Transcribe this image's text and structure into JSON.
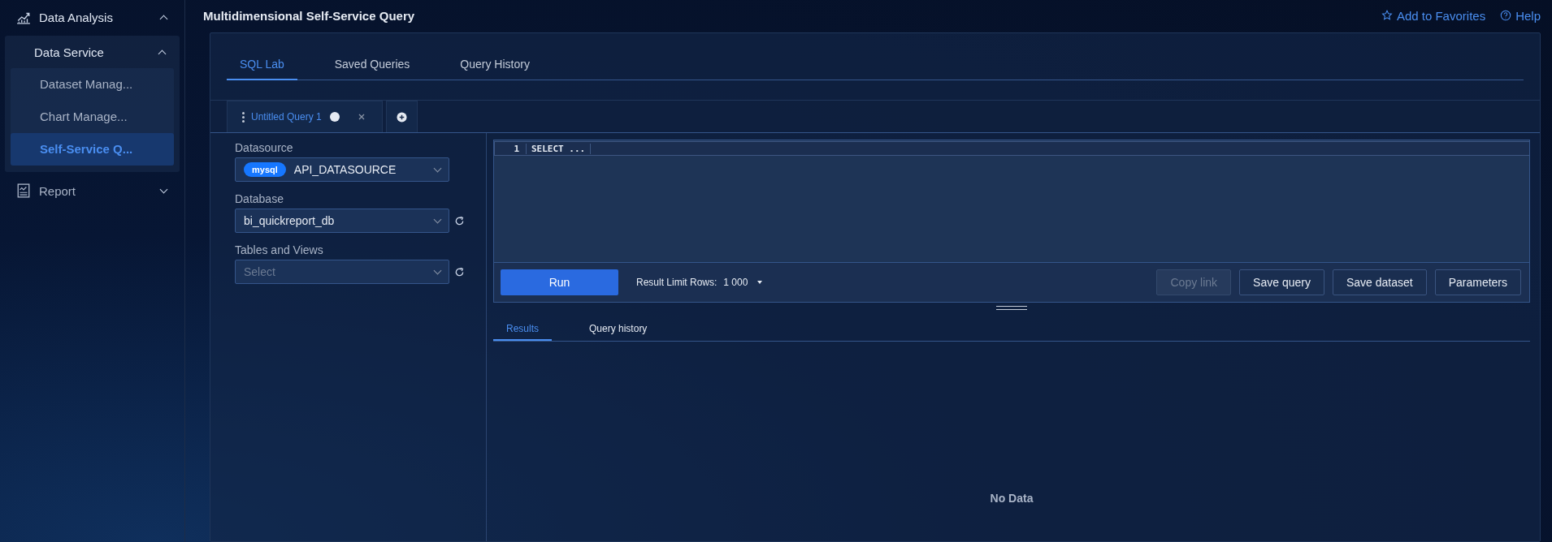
{
  "sidebar": {
    "items": [
      {
        "label": "Data Analysis",
        "expanded": true,
        "children": [
          {
            "label": "Data Service",
            "expanded": true,
            "children": [
              {
                "label": "Dataset Manag...",
                "selected": false
              },
              {
                "label": "Chart Manage...",
                "selected": false
              },
              {
                "label": "Self-Service Q...",
                "selected": true
              }
            ]
          }
        ]
      },
      {
        "label": "Report",
        "expanded": false
      }
    ]
  },
  "header": {
    "title": "Multidimensional Self-Service Query",
    "links": [
      {
        "label": "Add to Favorites"
      },
      {
        "label": "Help"
      }
    ]
  },
  "tabs": [
    {
      "label": "SQL Lab",
      "selected": true
    },
    {
      "label": "Saved Queries",
      "selected": false
    },
    {
      "label": "Query History",
      "selected": false
    }
  ],
  "query_tabs": [
    {
      "label": "Untitled Query 1",
      "selected": true
    }
  ],
  "form": [
    {
      "label": "Datasource",
      "kind": "tagged",
      "tag": "mysql",
      "value": "API_DATASOURCE",
      "refresh": false
    },
    {
      "label": "Database",
      "kind": "value",
      "value": "bi_quickreport_db",
      "refresh": true
    },
    {
      "label": "Tables and Views",
      "kind": "placeholder",
      "placeholder": "Select",
      "refresh": true
    }
  ],
  "editor": {
    "lines": [
      {
        "number": "1",
        "code": "SELECT ..."
      }
    ]
  },
  "toolbar": {
    "run": "Run",
    "limit_label": "Result Limit Rows:",
    "limit_value": "1 000",
    "buttons": [
      {
        "label": "Copy link",
        "disabled": true
      },
      {
        "label": "Save query",
        "disabled": false
      },
      {
        "label": "Save dataset",
        "disabled": false
      },
      {
        "label": "Parameters",
        "disabled": false
      }
    ]
  },
  "result_tabs": [
    {
      "label": "Results",
      "selected": true
    },
    {
      "label": "Query history",
      "selected": false
    }
  ],
  "results": {
    "empty_text": "No Data"
  }
}
